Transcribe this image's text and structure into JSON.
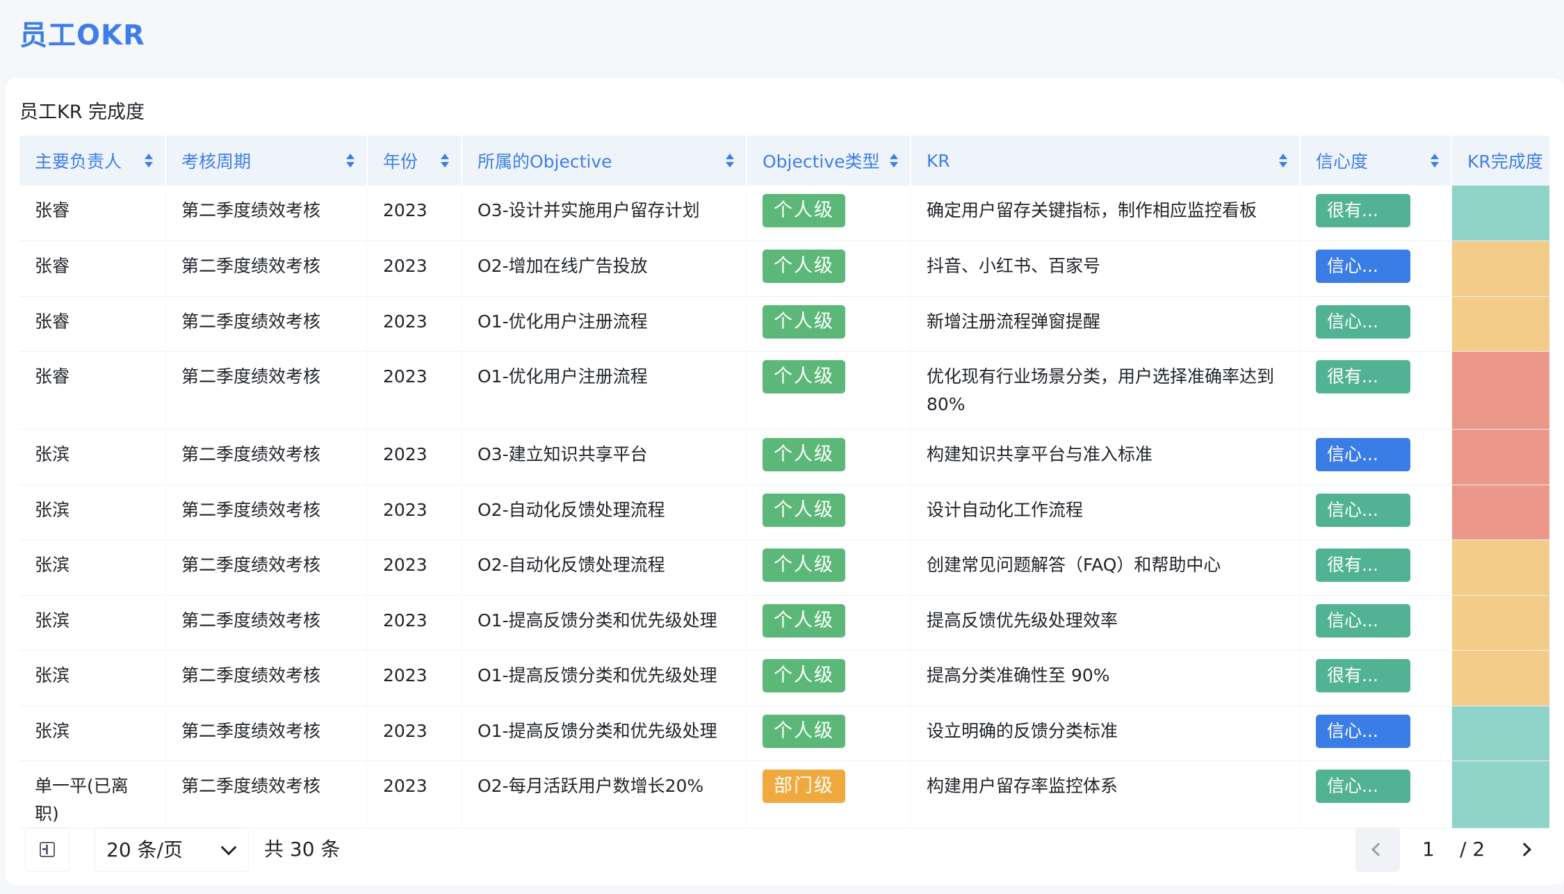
{
  "page": {
    "title": "员工OKR"
  },
  "card": {
    "title": "员工KR 完成度"
  },
  "colors": {
    "accent": "#3f7ee8",
    "tag_personal": "#5cb878",
    "tag_department": "#f0a93c",
    "conf_green": "#52b394",
    "conf_blue": "#3b7de6",
    "progress_teal": "#8fd3c9",
    "progress_orange": "#f3cc8a",
    "progress_red": "#eb988a"
  },
  "table": {
    "headers": [
      "主要负责人",
      "考核周期",
      "年份",
      "所属的Objective",
      "Objective类型",
      "KR",
      "信心度",
      "KR完成度"
    ],
    "rows": [
      {
        "owner": "张睿",
        "period": "第二季度绩效考核",
        "year": "2023",
        "objective": "O3-设计并实施用户留存计划",
        "type": "个人级",
        "type_kind": "personal",
        "kr": "确定用户留存关键指标，制作相应监控看板",
        "confidence": "很有...",
        "conf_color": "green",
        "progress_color": "teal"
      },
      {
        "owner": "张睿",
        "period": "第二季度绩效考核",
        "year": "2023",
        "objective": "O2-增加在线广告投放",
        "type": "个人级",
        "type_kind": "personal",
        "kr": "抖音、小红书、百家号",
        "confidence": "信心...",
        "conf_color": "blue",
        "progress_color": "orange"
      },
      {
        "owner": "张睿",
        "period": "第二季度绩效考核",
        "year": "2023",
        "objective": "O1-优化用户注册流程",
        "type": "个人级",
        "type_kind": "personal",
        "kr": "新增注册流程弹窗提醒",
        "confidence": "信心...",
        "conf_color": "green",
        "progress_color": "orange"
      },
      {
        "owner": "张睿",
        "period": "第二季度绩效考核",
        "year": "2023",
        "objective": "O1-优化用户注册流程",
        "type": "个人级",
        "type_kind": "personal",
        "kr": "优化现有行业场景分类，用户选择准确率达到80%",
        "confidence": "很有...",
        "conf_color": "green",
        "progress_color": "red",
        "tall": true
      },
      {
        "owner": "张滨",
        "period": "第二季度绩效考核",
        "year": "2023",
        "objective": "O3-建立知识共享平台",
        "type": "个人级",
        "type_kind": "personal",
        "kr": "构建知识共享平台与准入标准",
        "confidence": "信心...",
        "conf_color": "blue",
        "progress_color": "red"
      },
      {
        "owner": "张滨",
        "period": "第二季度绩效考核",
        "year": "2023",
        "objective": "O2-自动化反馈处理流程",
        "type": "个人级",
        "type_kind": "personal",
        "kr": "设计自动化工作流程",
        "confidence": "信心...",
        "conf_color": "green",
        "progress_color": "red"
      },
      {
        "owner": "张滨",
        "period": "第二季度绩效考核",
        "year": "2023",
        "objective": "O2-自动化反馈处理流程",
        "type": "个人级",
        "type_kind": "personal",
        "kr": "创建常见问题解答（FAQ）和帮助中心",
        "confidence": "很有...",
        "conf_color": "green",
        "progress_color": "orange"
      },
      {
        "owner": "张滨",
        "period": "第二季度绩效考核",
        "year": "2023",
        "objective": "O1-提高反馈分类和优先级处理",
        "type": "个人级",
        "type_kind": "personal",
        "kr": "提高反馈优先级处理效率",
        "confidence": "信心...",
        "conf_color": "green",
        "progress_color": "orange"
      },
      {
        "owner": "张滨",
        "period": "第二季度绩效考核",
        "year": "2023",
        "objective": "O1-提高反馈分类和优先级处理",
        "type": "个人级",
        "type_kind": "personal",
        "kr": "提高分类准确性至 90%",
        "confidence": "很有...",
        "conf_color": "green",
        "progress_color": "orange"
      },
      {
        "owner": "张滨",
        "period": "第二季度绩效考核",
        "year": "2023",
        "objective": "O1-提高反馈分类和优先级处理",
        "type": "个人级",
        "type_kind": "personal",
        "kr": "设立明确的反馈分类标准",
        "confidence": "信心...",
        "conf_color": "blue",
        "progress_color": "teal"
      },
      {
        "owner": "单一平(已离职)",
        "period": "第二季度绩效考核",
        "year": "2023",
        "objective": "O2-每月活跃用户数增长20%",
        "type": "部门级",
        "type_kind": "department",
        "kr": "构建用户留存率监控体系",
        "confidence": "信心...",
        "conf_color": "green",
        "progress_color": "teal"
      }
    ]
  },
  "pagination": {
    "page_size": "20 条/页",
    "total": "共 30 条",
    "current": "1",
    "total_pages": "/ 2"
  },
  "icons": {
    "density": "density-toggle-icon",
    "dropdown": "chevron-down-icon",
    "prev": "chevron-left-icon",
    "next": "chevron-right-icon",
    "sort": "sort-icon"
  }
}
